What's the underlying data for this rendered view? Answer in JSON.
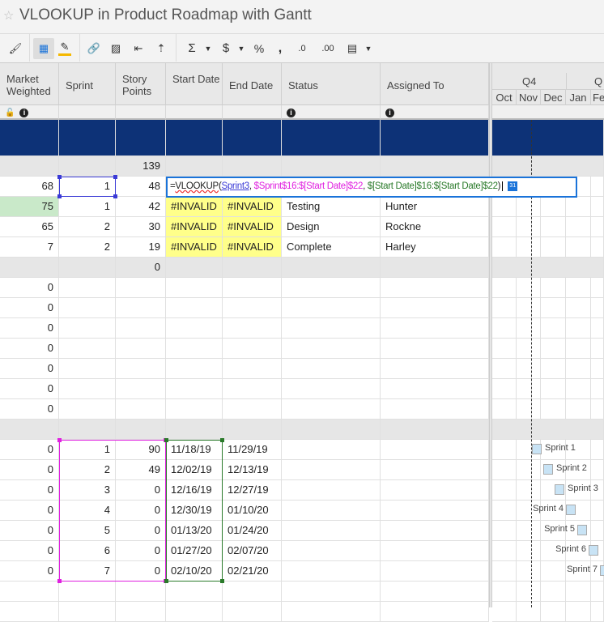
{
  "title": "VLOOKUP in Product Roadmap with Gantt",
  "toolbar": [
    "paint-format",
    "grid-view",
    "highlight",
    "link",
    "image",
    "indent",
    "outdent",
    "sum",
    "currency",
    "percent",
    "comma",
    "decrease-decimal",
    "increase-decimal",
    "date-format"
  ],
  "toolbar_text": {
    "sum": "Σ",
    "currency": "$",
    "percent": "%",
    "comma": ",",
    "dec": ".0",
    "inc": ".00"
  },
  "columns": [
    "Market Weighted",
    "Sprint",
    "Story Points",
    "Start Date",
    "End Date",
    "Status",
    "Assigned To"
  ],
  "gantt": {
    "quarter": "Q4",
    "quarter_next": "Q",
    "months": [
      "Oct",
      "Nov",
      "Dec",
      "Jan",
      "Feb"
    ]
  },
  "rows": [
    {
      "t": "blue",
      "v": [
        "",
        "",
        "",
        "",
        "",
        "",
        ""
      ]
    },
    {
      "t": "gray",
      "v": [
        "",
        "",
        "139",
        "",
        "",
        "",
        ""
      ]
    },
    {
      "v": [
        "68",
        "1",
        "48",
        "",
        "",
        "",
        ""
      ]
    },
    {
      "v": [
        "75",
        "1",
        "42",
        "#INVALID",
        "#INVALID",
        "Testing",
        "Hunter"
      ]
    },
    {
      "v": [
        "65",
        "2",
        "30",
        "#INVALID",
        "#INVALID",
        "Design",
        "Rockne"
      ]
    },
    {
      "v": [
        "7",
        "2",
        "19",
        "#INVALID",
        "#INVALID",
        "Complete",
        "Harley"
      ]
    },
    {
      "t": "gray",
      "v": [
        "",
        "",
        "0",
        "",
        "",
        "",
        ""
      ]
    },
    {
      "v": [
        "0",
        "",
        "",
        "",
        "",
        "",
        ""
      ]
    },
    {
      "v": [
        "0",
        "",
        "",
        "",
        "",
        "",
        ""
      ]
    },
    {
      "v": [
        "0",
        "",
        "",
        "",
        "",
        "",
        ""
      ]
    },
    {
      "v": [
        "0",
        "",
        "",
        "",
        "",
        "",
        ""
      ]
    },
    {
      "v": [
        "0",
        "",
        "",
        "",
        "",
        "",
        ""
      ]
    },
    {
      "v": [
        "0",
        "",
        "",
        "",
        "",
        "",
        ""
      ]
    },
    {
      "v": [
        "0",
        "",
        "",
        "",
        "",
        "",
        ""
      ]
    },
    {
      "t": "gray",
      "v": [
        "",
        "",
        "",
        "",
        "",
        "",
        ""
      ]
    },
    {
      "v": [
        "0",
        "1",
        "90",
        "11/18/19",
        "11/29/19",
        "",
        ""
      ],
      "bar": "Sprint 1"
    },
    {
      "v": [
        "0",
        "2",
        "49",
        "12/02/19",
        "12/13/19",
        "",
        ""
      ],
      "bar": "Sprint 2"
    },
    {
      "v": [
        "0",
        "3",
        "0",
        "12/16/19",
        "12/27/19",
        "",
        ""
      ],
      "bar": "Sprint 3"
    },
    {
      "v": [
        "0",
        "4",
        "0",
        "12/30/19",
        "01/10/20",
        "",
        ""
      ],
      "bar": "Sprint 4"
    },
    {
      "v": [
        "0",
        "5",
        "0",
        "01/13/20",
        "01/24/20",
        "",
        ""
      ],
      "bar": "Sprint 5"
    },
    {
      "v": [
        "0",
        "6",
        "0",
        "01/27/20",
        "02/07/20",
        "",
        ""
      ],
      "bar": "Sprint 6"
    },
    {
      "v": [
        "0",
        "7",
        "0",
        "02/10/20",
        "02/21/20",
        "",
        ""
      ],
      "bar": "Sprint 7"
    },
    {
      "v": [
        "",
        "",
        "",
        "",
        "",
        "",
        ""
      ]
    },
    {
      "v": [
        "",
        "",
        "",
        "",
        "",
        "",
        ""
      ]
    }
  ],
  "formula": {
    "prefix": "=",
    "fn": "VLOOKUP",
    "open": "(",
    "arg1": "Sprint3",
    "comma1": ", ",
    "arg2": "$Sprint$16:$[Start Date]$22",
    "comma2": ", ",
    "arg3": "$[Start Date]$16:$[Start Date]$22",
    "close": ")"
  },
  "colors": {
    "header_blue": "#0d3277",
    "invalid": "#ffff8a",
    "highlight_green": "#c9e9c9",
    "arg1": "#3a3ad6",
    "arg2": "#e020e0",
    "arg3": "#2a7a2a",
    "selection": "#1a73d9"
  }
}
